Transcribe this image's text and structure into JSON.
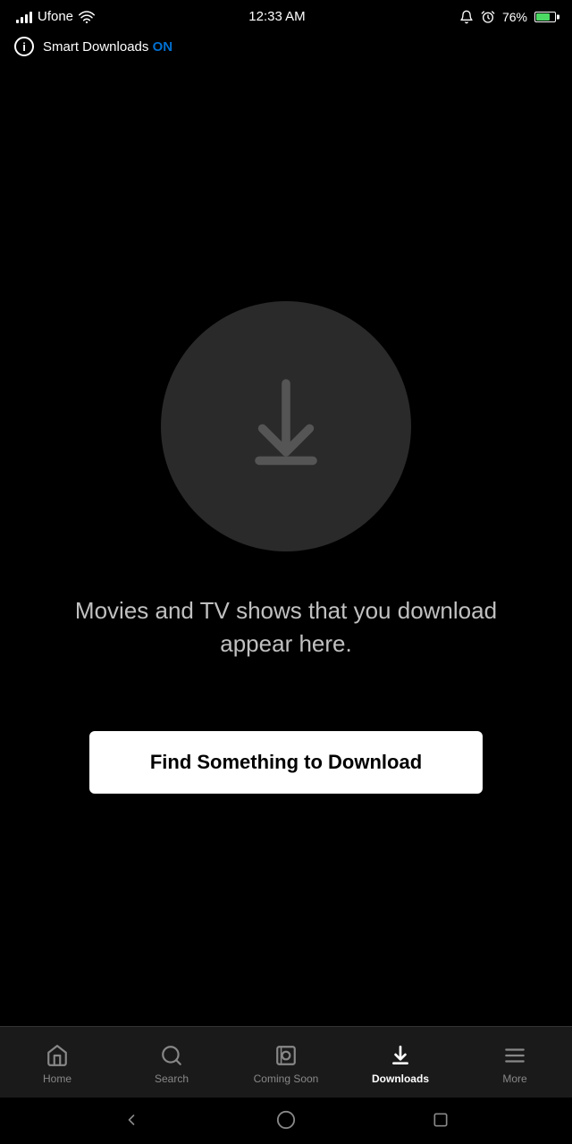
{
  "statusBar": {
    "carrier": "Ufone",
    "time": "12:33 AM",
    "battery": "76%",
    "batteryPercent": 76
  },
  "smartDownloads": {
    "label": "Smart Downloads",
    "status": "ON",
    "infoIcon": "i"
  },
  "mainContent": {
    "downloadIcon": "download-icon",
    "emptyMessage": "Movies and TV shows that you download appear here.",
    "findButtonLabel": "Find Something to Download"
  },
  "bottomNav": {
    "items": [
      {
        "id": "home",
        "label": "Home",
        "active": false
      },
      {
        "id": "search",
        "label": "Search",
        "active": false
      },
      {
        "id": "coming-soon",
        "label": "Coming Soon",
        "active": false
      },
      {
        "id": "downloads",
        "label": "Downloads",
        "active": true
      },
      {
        "id": "more",
        "label": "More",
        "active": false
      }
    ]
  },
  "androidNav": {
    "backIcon": "back-triangle",
    "homeIcon": "home-circle",
    "recentIcon": "recent-square"
  }
}
